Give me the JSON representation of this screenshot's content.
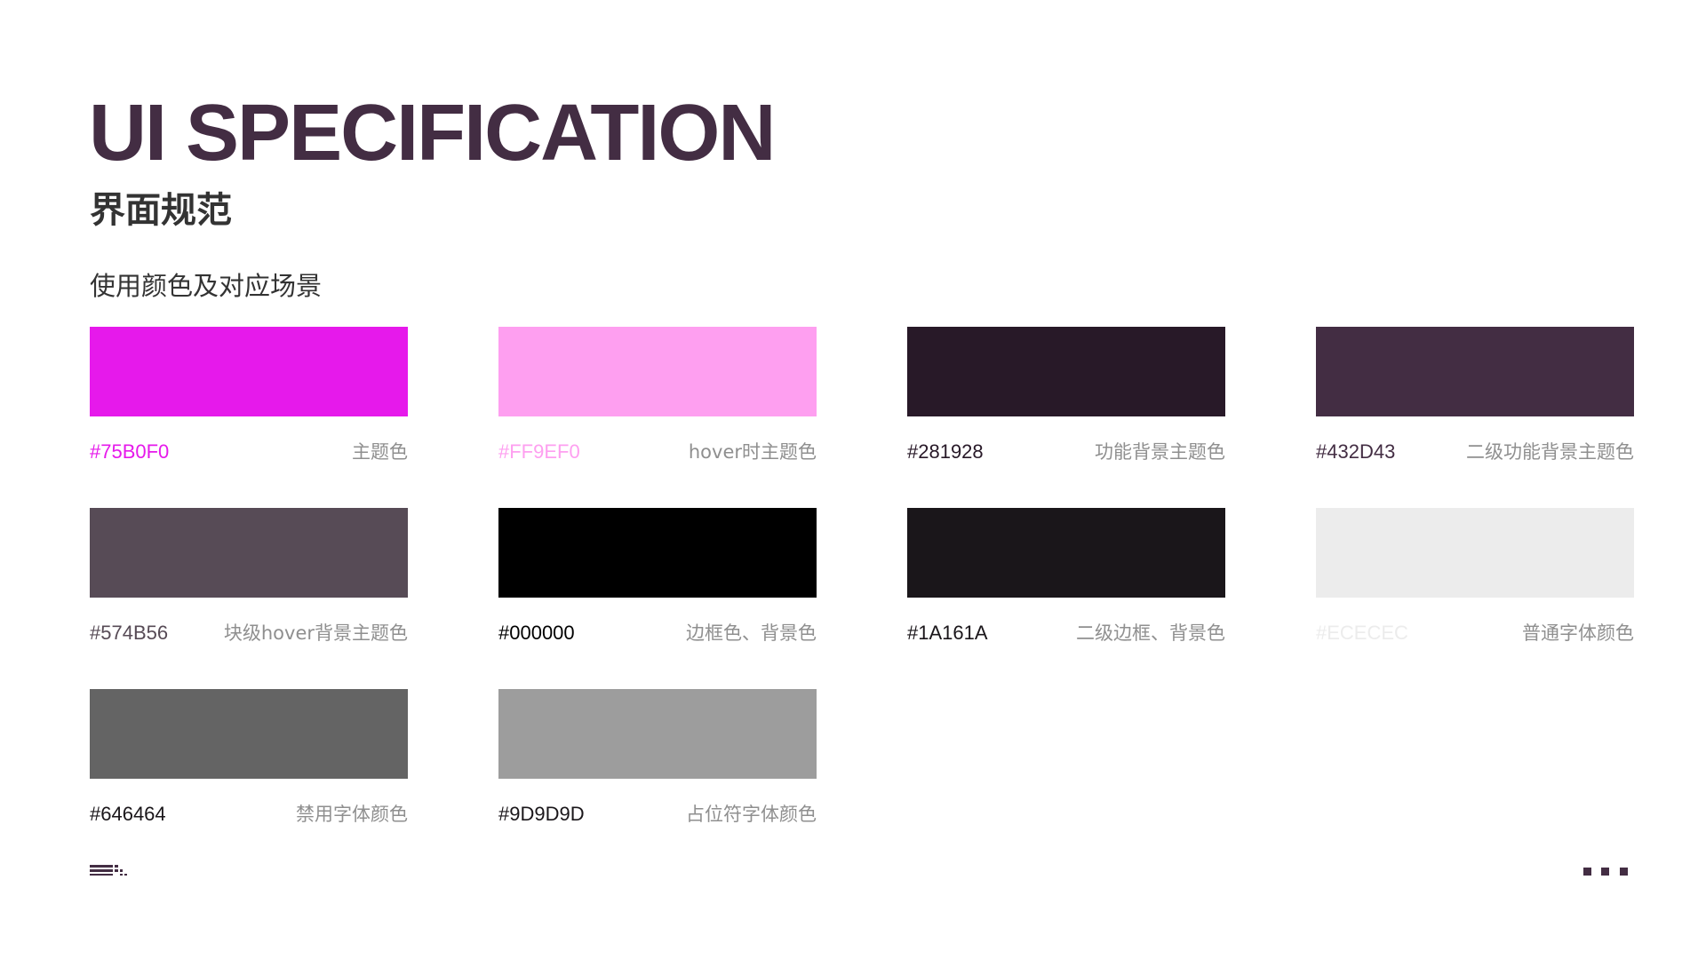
{
  "header": {
    "title": "UI SPECIFICATION",
    "subtitle": "界面规范"
  },
  "section": {
    "heading": "使用颜色及对应场景"
  },
  "swatches": [
    {
      "hex": "#75B0F0",
      "color": "#E619EB",
      "hex_text_color": "#E619EB",
      "description": "主题色"
    },
    {
      "hex": "#FF9EF0",
      "color": "#FE9FF0",
      "hex_text_color": "#FE9FF0",
      "description": "hover时主题色"
    },
    {
      "hex": "#281928",
      "color": "#281928",
      "hex_text_color": "#281928",
      "description": "功能背景主题色"
    },
    {
      "hex": "#432D43",
      "color": "#432D43",
      "hex_text_color": "#432D43",
      "description": "二级功能背景主题色"
    },
    {
      "hex": "#574B56",
      "color": "#574B56",
      "hex_text_color": "#574B56",
      "description": "块级hover背景主题色"
    },
    {
      "hex": "#000000",
      "color": "#000000",
      "hex_text_color": "#000000",
      "description": "边框色、背景色"
    },
    {
      "hex": "#1A161A",
      "color": "#1A161A",
      "hex_text_color": "#1A161A",
      "description": "二级边框、背景色"
    },
    {
      "hex": "#ECECEC",
      "color": "#ECECEC",
      "hex_text_color": "#ECECEC",
      "description": "普通字体颜色"
    },
    {
      "hex": "#646464",
      "color": "#646464",
      "hex_text_color": "#1A161A",
      "description": "禁用字体颜色"
    },
    {
      "hex": "#9D9D9D",
      "color": "#9D9D9D",
      "hex_text_color": "#1A161A",
      "description": "占位符字体颜色"
    }
  ],
  "footer": {
    "left_icon": "menu-lines-icon",
    "right_icon": "more-dots-icon",
    "accent_color": "#432D43"
  }
}
